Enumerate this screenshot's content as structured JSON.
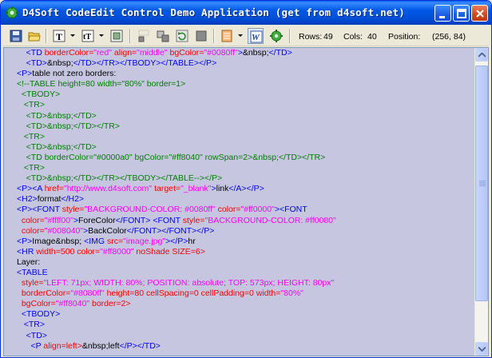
{
  "window": {
    "title": "D4Soft CodeEdit Control Demo Application (get from d4soft.net)"
  },
  "colors": {
    "tag": "#0000ff",
    "attr": "#ff0000",
    "value": "#ff00ff",
    "comment": "#008000",
    "text": "#000000",
    "editor_bg": "#c6c6e0"
  },
  "toolbar": {
    "items": [
      "save-icon",
      "open-folder-icon",
      "text-format-icon",
      "text-size-icon",
      "fill-color-icon",
      "align-icon",
      "layout-icon",
      "refresh-icon",
      "stop-icon",
      "options-icon",
      "word-wrap-icon",
      "settings-gear-icon"
    ],
    "rows_label": "Rows:",
    "rows_value": "49",
    "cols_label": "Cols:",
    "cols_value": "40",
    "position_label": "Position:",
    "position_value": "(256, 84)"
  },
  "code_lines": [
    [
      [
        "    ",
        "text"
      ],
      [
        "<TD ",
        "tag"
      ],
      [
        "borderColor=",
        "attr"
      ],
      [
        "\"red\"",
        "value"
      ],
      [
        " align=",
        "attr"
      ],
      [
        "\"middle\"",
        "value"
      ],
      [
        " bgColor=",
        "attr"
      ],
      [
        "\"#0080ff\"",
        "value"
      ],
      [
        ">",
        "tag"
      ],
      [
        "&nbsp;",
        "text"
      ],
      [
        "</TD>",
        "tag"
      ]
    ],
    [
      [
        "    ",
        "text"
      ],
      [
        "<TD>",
        "tag"
      ],
      [
        "&nbsp;",
        "text"
      ],
      [
        "</TD></TR></TBODY></TABLE></P>",
        "tag"
      ]
    ],
    [
      [
        "",
        "text"
      ],
      [
        "<P>",
        "tag"
      ],
      [
        "table not zero borders:",
        "text"
      ]
    ],
    [
      [
        "",
        "text"
      ],
      [
        "<!--TABLE height=80 width=\"80%\" border=1>",
        "comment"
      ]
    ],
    [
      [
        "  ",
        "text"
      ],
      [
        "<TBODY>",
        "comment"
      ]
    ],
    [
      [
        "   ",
        "text"
      ],
      [
        "<TR>",
        "comment"
      ]
    ],
    [
      [
        "    ",
        "text"
      ],
      [
        "<TD>&nbsp;</TD>",
        "comment"
      ]
    ],
    [
      [
        "    ",
        "text"
      ],
      [
        "<TD>&nbsp;</TD></TR>",
        "comment"
      ]
    ],
    [
      [
        "   ",
        "text"
      ],
      [
        "<TR>",
        "comment"
      ]
    ],
    [
      [
        "    ",
        "text"
      ],
      [
        "<TD>&nbsp;</TD>",
        "comment"
      ]
    ],
    [
      [
        "    ",
        "text"
      ],
      [
        "<TD borderColor=\"#0000a0\" bgColor=\"#ff8040\" rowSpan=2>&nbsp;</TD></TR>",
        "comment"
      ]
    ],
    [
      [
        "   ",
        "text"
      ],
      [
        "<TR>",
        "comment"
      ]
    ],
    [
      [
        "    ",
        "text"
      ],
      [
        "<TD>&nbsp;</TD></TR></TBODY></TABLE--></P>",
        "comment"
      ]
    ],
    [
      [
        "",
        "text"
      ],
      [
        "<P><A ",
        "tag"
      ],
      [
        "href=",
        "attr"
      ],
      [
        "\"http://www.d4soft.com\"",
        "value"
      ],
      [
        " target=",
        "attr"
      ],
      [
        "\"_blank\"",
        "value"
      ],
      [
        ">",
        "tag"
      ],
      [
        "link",
        "text"
      ],
      [
        "</A></P>",
        "tag"
      ]
    ],
    [
      [
        "",
        "text"
      ],
      [
        "<H2>",
        "tag"
      ],
      [
        "format",
        "text"
      ],
      [
        "</H2>",
        "tag"
      ]
    ],
    [
      [
        "",
        "text"
      ],
      [
        "<P><FONT ",
        "tag"
      ],
      [
        "style=",
        "attr"
      ],
      [
        "\"BACKGROUND-COLOR: #0080ff\"",
        "value"
      ],
      [
        " color=",
        "attr"
      ],
      [
        "\"#ff0000\"",
        "value"
      ],
      [
        "><FONT",
        "tag"
      ]
    ],
    [
      [
        "  ",
        "text"
      ],
      [
        "color=",
        "attr"
      ],
      [
        "\"#ffff00\"",
        "value"
      ],
      [
        ">",
        "tag"
      ],
      [
        "ForeColor",
        "text"
      ],
      [
        "</FONT> <FONT ",
        "tag"
      ],
      [
        "style=",
        "attr"
      ],
      [
        "\"BACKGROUND-COLOR: #ff0080\"",
        "value"
      ]
    ],
    [
      [
        "  ",
        "text"
      ],
      [
        "color=",
        "attr"
      ],
      [
        "\"#008040\"",
        "value"
      ],
      [
        ">",
        "tag"
      ],
      [
        "BackColor",
        "text"
      ],
      [
        "</FONT></FONT></P>",
        "tag"
      ]
    ],
    [
      [
        "",
        "text"
      ],
      [
        "<P>",
        "tag"
      ],
      [
        "Image&nbsp; ",
        "text"
      ],
      [
        "<IMG ",
        "tag"
      ],
      [
        "src=",
        "attr"
      ],
      [
        "\"image.jpg\"",
        "value"
      ],
      [
        "></P>",
        "tag"
      ],
      [
        "hr",
        "text"
      ]
    ],
    [
      [
        "",
        "text"
      ],
      [
        "<HR ",
        "tag"
      ],
      [
        "width=500 color=",
        "attr"
      ],
      [
        "\"#ff8000\"",
        "value"
      ],
      [
        " noShade SIZE=6>",
        "attr"
      ]
    ],
    [
      [
        "",
        "text"
      ],
      [
        "Layer:",
        "text"
      ]
    ],
    [
      [
        "",
        "text"
      ],
      [
        "<TABLE",
        "tag"
      ]
    ],
    [
      [
        "  ",
        "text"
      ],
      [
        "style=",
        "attr"
      ],
      [
        "\"LEFT: 71px; WIDTH: 80%; POSITION: absolute; TOP: 573px; HEIGHT: 80px\"",
        "value"
      ]
    ],
    [
      [
        "  ",
        "text"
      ],
      [
        "borderColor=",
        "attr"
      ],
      [
        "\"#8080ff\"",
        "value"
      ],
      [
        " height=80 cellSpacing=0 cellPadding=0 width=",
        "attr"
      ],
      [
        "\"80%\"",
        "value"
      ]
    ],
    [
      [
        "  ",
        "text"
      ],
      [
        "bgColor=",
        "attr"
      ],
      [
        "\"#ff8040\"",
        "value"
      ],
      [
        " border=2>",
        "attr"
      ]
    ],
    [
      [
        "  ",
        "text"
      ],
      [
        "<TBODY>",
        "tag"
      ]
    ],
    [
      [
        "   ",
        "text"
      ],
      [
        "<TR>",
        "tag"
      ]
    ],
    [
      [
        "    ",
        "text"
      ],
      [
        "<TD>",
        "tag"
      ]
    ],
    [
      [
        "      ",
        "text"
      ],
      [
        "<P ",
        "tag"
      ],
      [
        "align=left>",
        "attr"
      ],
      [
        "&nbsp;left",
        "text"
      ],
      [
        "</P></TD>",
        "tag"
      ]
    ]
  ]
}
